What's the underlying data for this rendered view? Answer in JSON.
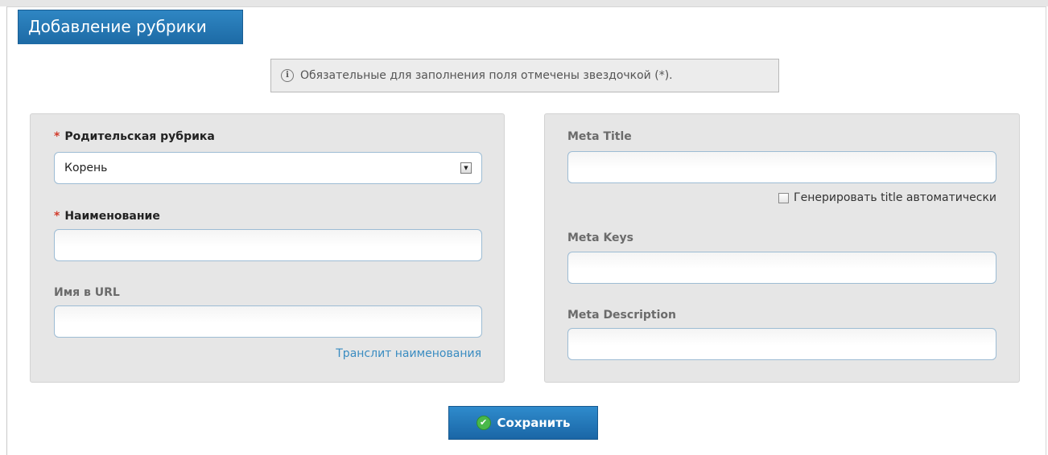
{
  "page_title": "Добавление рубрики",
  "notice": {
    "icon": "info-icon",
    "text": "Обязательные для заполнения поля отмечены звездочкой (*)."
  },
  "left_panel": {
    "required_mark": "*",
    "parent_label": "Родительская рубрика",
    "parent_value": "Корень",
    "name_label": "Наименование",
    "name_value": "",
    "url_label": "Имя в URL",
    "url_value": "",
    "translit_link": "Транслит наименования"
  },
  "right_panel": {
    "meta_title_label": "Meta Title",
    "meta_title_value": "",
    "auto_title_checkbox_label": "Генерировать title автоматически",
    "auto_title_checked": false,
    "meta_keys_label": "Meta Keys",
    "meta_keys_value": "",
    "meta_description_label": "Meta Description",
    "meta_description_value": ""
  },
  "save_button": {
    "label": "Сохранить",
    "icon": "check-circle-icon"
  },
  "colors": {
    "header_blue": "#1d6aa5",
    "required_red": "#d23b2b",
    "link_blue": "#3a8cc1",
    "panel_grey": "#e6e6e6",
    "success_green": "#49b84a"
  }
}
